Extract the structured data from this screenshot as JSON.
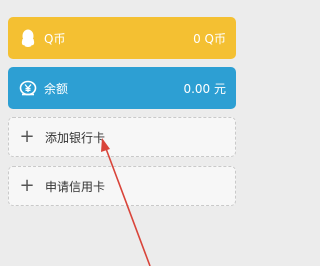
{
  "qcoin": {
    "label": "Q币",
    "value": "0 Q币",
    "icon": "penguin-icon"
  },
  "balance": {
    "label": "余额",
    "value": "0.00 元",
    "icon": "yuan-coin-icon"
  },
  "actions": [
    {
      "label": "添加银行卡",
      "icon": "plus-icon"
    },
    {
      "label": "申请信用卡",
      "icon": "plus-icon"
    }
  ],
  "colors": {
    "qcoin_bg": "#f4c032",
    "balance_bg": "#2d9fd3",
    "arrow": "#d9443a"
  }
}
